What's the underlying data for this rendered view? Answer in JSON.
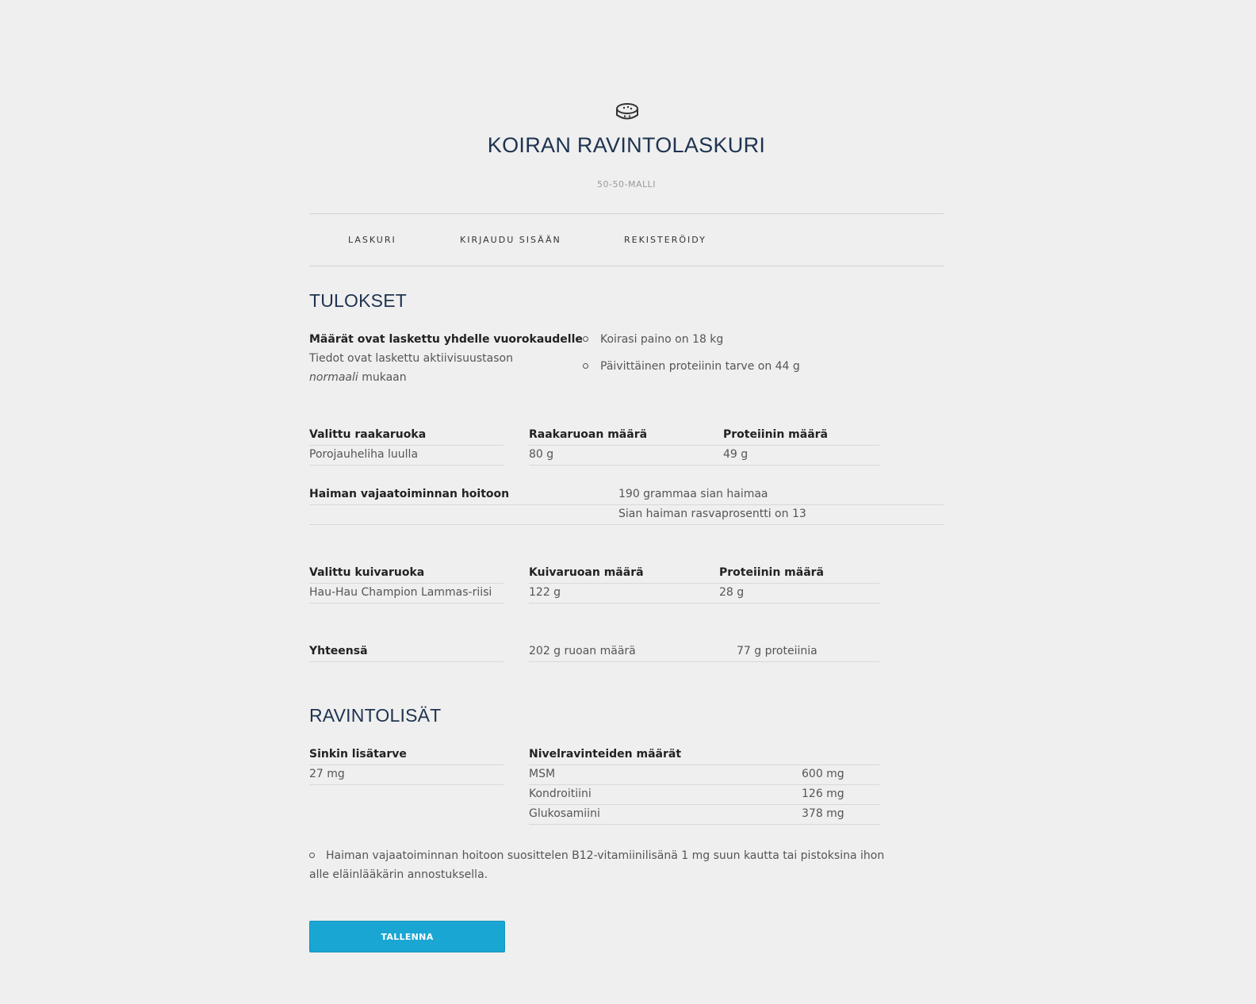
{
  "header": {
    "logo_icon": "dog-bowl-icon",
    "title": "KOIRAN RAVINTOLASKURI",
    "subtitle": "50-50-MALLI"
  },
  "nav": {
    "items": [
      {
        "label": "LASKURI"
      },
      {
        "label": "KIRJAUDU SISÄÄN"
      },
      {
        "label": "REKISTERÖIDY"
      }
    ]
  },
  "results": {
    "heading": "TULOKSET",
    "intro_title": "Määrät ovat laskettu yhdelle vuorokaudelle",
    "intro_line1": "Tiedot ovat laskettu aktiivisuustason",
    "intro_level": "normaali",
    "intro_suffix": "mukaan",
    "bullets": [
      "Koirasi paino on 18 kg",
      "Päivittäinen proteiinin tarve on 44 g"
    ],
    "raw": {
      "col1_header": "Valittu raakaruoka",
      "col2_header": "Raakaruoan määrä",
      "col3_header": "Proteiinin määrä",
      "food": "Porojauheliha luulla",
      "amount": "80 g",
      "protein": "49 g"
    },
    "pancreas": {
      "header": "Haiman vajaatoiminnan hoitoon",
      "line1": "190 grammaa sian haimaa",
      "line2": "Sian haiman rasvaprosentti on 13"
    },
    "dry": {
      "col1_header": "Valittu kuivaruoka",
      "col2_header": "Kuivaruoan määrä",
      "col3_header": "Proteiinin määrä",
      "food": "Hau-Hau Champion Lammas-riisi",
      "amount": "122 g",
      "protein": "28 g"
    },
    "total": {
      "label": "Yhteensä",
      "food_amount": "202 g ruoan määrä",
      "protein_amount": "77 g proteiinia"
    }
  },
  "supplements": {
    "heading": "RAVINTOLISÄT",
    "zinc_header": "Sinkin lisätarve",
    "zinc_value": "27 mg",
    "joint_header": "Nivelravinteiden määrät",
    "joint_rows": [
      {
        "name": "MSM",
        "value": "600 mg"
      },
      {
        "name": "Kondroitiini",
        "value": "126 mg"
      },
      {
        "name": "Glukosamiini",
        "value": "378 mg"
      }
    ],
    "note_line1": "Haiman vajaatoiminnan hoitoon suosittelen B12-vitamiinilisänä 1 mg suun kautta tai pistoksina ihon",
    "note_line2": "alle eläinlääkärin annostuksella."
  },
  "actions": {
    "save_label": "TALLENNA"
  },
  "colors": {
    "background": "#efefef",
    "title": "#1e3350",
    "button": "#1aa6d3"
  }
}
